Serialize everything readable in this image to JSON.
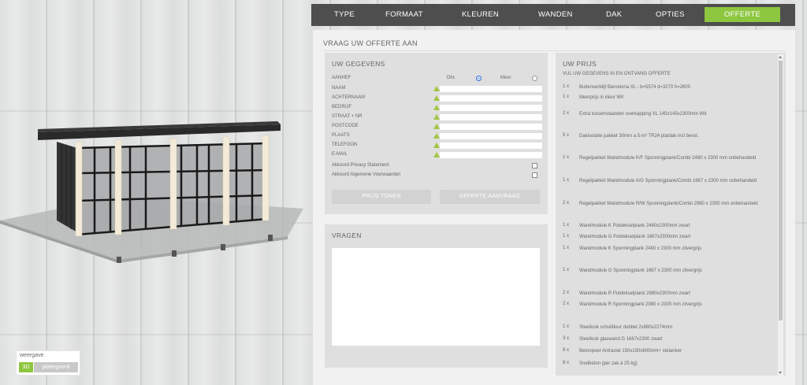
{
  "nav": {
    "tabs": [
      "TYPE",
      "FORMAAT",
      "KLEUREN",
      "WANDEN",
      "DAK",
      "OPTIES"
    ],
    "active_tab": "OFFERTE"
  },
  "page_title": "VRAAG UW OFFERTE AAN",
  "gegevens": {
    "title": "UW GEGEVENS",
    "aanhef_label": "AANHEF",
    "dhr_label": "Dhr.",
    "mevr_label": "Mevr.",
    "dhr_selected": true,
    "fields": [
      "NAAM",
      "ACHTERNAAM",
      "BEDRIJF",
      "STRAAT + NR",
      "POSTCODE",
      "PLAATS",
      "TELEFOON",
      "E-MAIL"
    ],
    "privacy_label": "Akkoord Privacy Statement",
    "voorwaarden_label": "Akkoord Algemene Voorwaarden",
    "btn_prijs": "PRIJS TONEN",
    "btn_offerte": "OFFERTE AANVRAAG"
  },
  "vragen": {
    "title": "VRAGEN"
  },
  "prijs": {
    "title": "UW PRIJS",
    "subtitle": "VUL UW GEGEVENS IN EN ONTVANG OFFERTE",
    "items": [
      {
        "qty": "1 x",
        "desc": "Buitenverblijf Barcelona XL - b=5574 d=3270 h=2600"
      },
      {
        "qty": "1 x",
        "desc": "Meerprijs in kleur Wit"
      },
      {
        "qty": "2 x",
        "desc": "Extra tussenstaander overkapping XL 145x145x2300mm Wit"
      },
      {
        "qty": "5 x",
        "desc": "Dakisolatie pakket 30mm a 5-m² TR24 platdak incl bevst."
      },
      {
        "qty": "1 x",
        "desc": "Regelpakket Wandmodule K/F Sponningplank/Combi 2480 x 2300 mm  onbehandeld"
      },
      {
        "qty": "1 x",
        "desc": "Regelpakket Wandmodule A/G Sponningplank/Combi 1667 x 2300 mm  onbehandeld"
      },
      {
        "qty": "2 x",
        "desc": "Regelpakket Wandmodule R/W Sponningplank/Combi 2980 x 2300 mm  onbehandeld"
      },
      {
        "qty": "1 x",
        "desc": "Wandmodule K Potdekselplank 2480x2300mm zwart"
      },
      {
        "qty": "1 x",
        "desc": "Wandmodule G Potdekselplank 1667x2300mm zwart"
      },
      {
        "qty": "1 x",
        "desc": "Wandmodule K Sponningplank 2480 x 2300 mm  zilvergrijs"
      },
      {
        "qty": "1 x",
        "desc": "Wandmodule G Sponningplank 1667 x 2300 mm  zilvergrijs"
      },
      {
        "qty": "2 x",
        "desc": "Wandmodule R Potdekselplank 2980x2300mm zwart"
      },
      {
        "qty": "2 x",
        "desc": "Wandmodule R Sponningplank 2980 x 2300 mm  zilvergrijs"
      },
      {
        "qty": "1 x",
        "desc": "Steellook schuifdeur dubbel 2x880x2274mm"
      },
      {
        "qty": "3 x",
        "desc": "Steellook glaswand G 1667x2300  zwart"
      },
      {
        "qty": "8 x",
        "desc": "Betonpoer Antraciet 150x150x600mm+ stelanker"
      },
      {
        "qty": "8 x",
        "desc": "Snelbeton (per zak  à  25 kg)"
      }
    ]
  },
  "weergave": {
    "label": "weergave",
    "btn_3d": "3D",
    "btn_plat": "plattegrond"
  },
  "colors": {
    "accent": "#8dc63f",
    "nav_bg": "#4e4e4e"
  }
}
